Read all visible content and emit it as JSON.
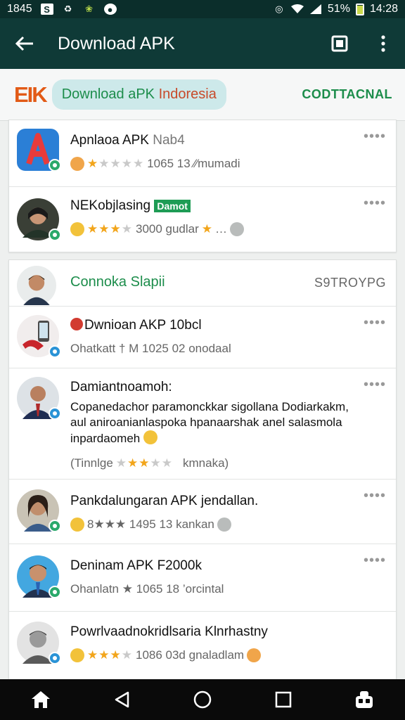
{
  "status_bar": {
    "time_left": "1845",
    "battery_percent": "51%",
    "time_right": "14:28",
    "icons": [
      "notification-square-icon",
      "alarm-icon",
      "leaf-icon",
      "circle-app-icon",
      "vibrate-icon",
      "wifi-icon",
      "signal-icon",
      "battery-icon"
    ]
  },
  "app_bar": {
    "title": "Download APK",
    "icons": [
      "back-arrow-icon",
      "square-icon",
      "overflow-menu-icon"
    ]
  },
  "banner": {
    "logo": "EIK",
    "pill_part1": "Download aPK ",
    "pill_part2": "Indoresia",
    "right_label": "CODTTACNAL"
  },
  "card1": {
    "rows": [
      {
        "title": "Apnlaoa APK ",
        "title_muted": "Nab4",
        "meta": "1065 13 ⁄⁄mumadi",
        "stars_on": 1,
        "avatar": "app-logo-a"
      },
      {
        "title": "NEKobjlasing ",
        "tag": "Damot",
        "meta": "3000 gudlar",
        "meta_tail": "…",
        "stars_on": 3,
        "avatar": "person"
      }
    ]
  },
  "card2": {
    "header": {
      "title": "Connoka Slapii",
      "right_label": "S9TROYPG"
    },
    "rows": [
      {
        "title": "Dwnioan AKP 10bcl",
        "meta": "Ohatkatt † M 1025 02  onodaal"
      },
      {
        "title": "Damiantnoamoh:",
        "desc_line1": "Copanedachor paramonckkar sigollana Dodiarkakm,",
        "desc_line2": "aul aniroanianlaspoka hpanaarshak anel salasmola",
        "desc_line3": "inpardaomeh",
        "meta_prefix": "(Tinnlge",
        "meta_suffix": "kmnaka)",
        "stars_on": 3
      },
      {
        "title": "Pankdalungaran APK jendallan.",
        "meta": "8★★★ 1495 13 kankan"
      },
      {
        "title": "Deninam APK F2000k",
        "meta": "Ohanlatn ★ 1065 18 ’orcintal"
      },
      {
        "title": "Powrlvaadnokridlsaria Klnrhastny",
        "meta": "1086 03d gnaladlam",
        "stars_on": 3
      }
    ]
  },
  "nav_bar": {
    "icons": [
      "home-icon",
      "back-triangle-icon",
      "home-circle-icon",
      "recents-square-icon",
      "assistant-icon"
    ]
  }
}
